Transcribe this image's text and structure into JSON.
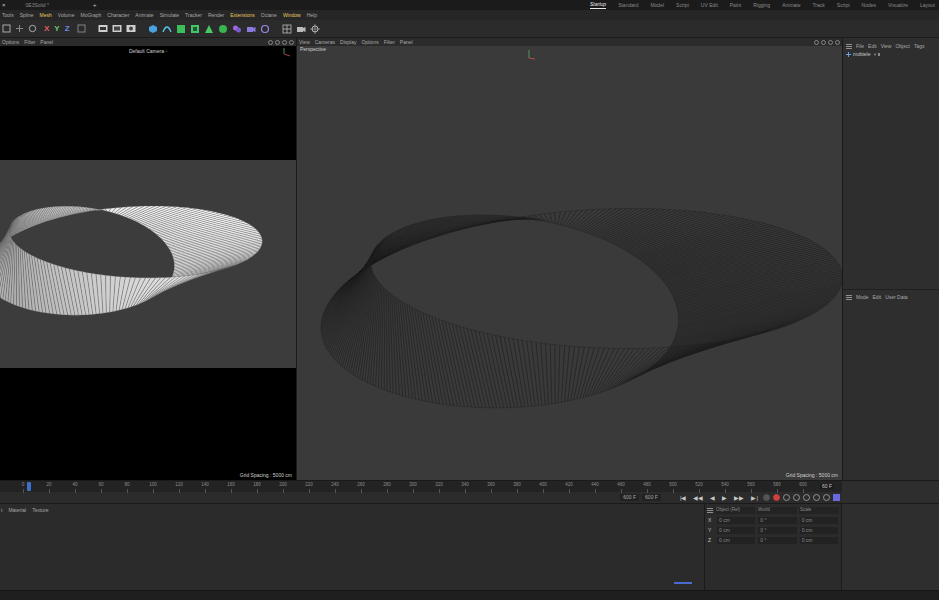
{
  "app_bar": {
    "close": "×",
    "document": "0E3Solid *",
    "add": "+"
  },
  "layouts": [
    {
      "label": "Startup",
      "selected": true
    },
    {
      "label": "Standard",
      "selected": false
    },
    {
      "label": "Model",
      "selected": false
    },
    {
      "label": "Script",
      "selected": false
    },
    {
      "label": "UV Edit",
      "selected": false
    },
    {
      "label": "Paint",
      "selected": false
    },
    {
      "label": "Rigging",
      "selected": false
    },
    {
      "label": "Animate",
      "selected": false
    },
    {
      "label": "Track",
      "selected": false
    },
    {
      "label": "Script",
      "selected": false
    },
    {
      "label": "Nodes",
      "selected": false
    },
    {
      "label": "Visualize",
      "selected": false
    },
    {
      "label": "Layout",
      "selected": false
    }
  ],
  "menu": [
    {
      "label": "Tools",
      "highlighted": false
    },
    {
      "label": "Spline",
      "highlighted": false
    },
    {
      "label": "Mesh",
      "highlighted": true
    },
    {
      "label": "Volume",
      "highlighted": false
    },
    {
      "label": "MoGraph",
      "highlighted": false
    },
    {
      "label": "Character",
      "highlighted": false
    },
    {
      "label": "Animate",
      "highlighted": false
    },
    {
      "label": "Simulate",
      "highlighted": false
    },
    {
      "label": "Tracker",
      "highlighted": false
    },
    {
      "label": "Render",
      "highlighted": false
    },
    {
      "label": "Extensions",
      "highlighted": true
    },
    {
      "label": "Octane",
      "highlighted": false
    },
    {
      "label": "Window",
      "highlighted": true
    },
    {
      "label": "Help",
      "highlighted": false
    }
  ],
  "axis_buttons": [
    {
      "label": "X",
      "color": "#e05a5a"
    },
    {
      "label": "Y",
      "color": "#6cc46c"
    },
    {
      "label": "Z",
      "color": "#6a8ae6"
    }
  ],
  "viewports": [
    {
      "menu": [
        "Options",
        "Filter",
        "Panel"
      ],
      "title": "Default Camera ◦",
      "grid": "Grid Spacing : 5000 cm",
      "kind": "shaded"
    },
    {
      "menu": [
        "View",
        "Cameras",
        "Display",
        "Options",
        "Filter",
        "Panel"
      ],
      "title": "Perspective",
      "grid": "Grid Spacing : 5000 cm",
      "kind": "wireframe"
    }
  ],
  "object_manager": {
    "menu": [
      "File",
      "Edit",
      "View",
      "Object",
      "Tags"
    ],
    "objects": [
      {
        "name": "mobiele",
        "selected": false
      }
    ]
  },
  "attributes": {
    "menu": [
      "Mode",
      "Edit",
      "User Data"
    ]
  },
  "timeline": {
    "ticks": [
      "0",
      "20",
      "40",
      "60",
      "80",
      "100",
      "120",
      "140",
      "160",
      "180",
      "200",
      "220",
      "240",
      "260",
      "280",
      "300",
      "320",
      "340",
      "360",
      "380",
      "400",
      "420",
      "440",
      "460",
      "480",
      "500",
      "520",
      "540",
      "560",
      "580",
      "600"
    ],
    "frame": "60 F",
    "playhead": {
      "level": 0.005
    }
  },
  "transport": {
    "start": "600 F",
    "end": "600 F",
    "buttons": [
      "|◀",
      "◀◀",
      "◀",
      "▶",
      "▶▶",
      "▶|"
    ]
  },
  "material_menu": [
    "t",
    "Material",
    "Texture"
  ],
  "coordinates": {
    "headers": [
      "Object (Rel)",
      "World",
      "Scale"
    ],
    "rows": [
      {
        "axis": "X",
        "position": "0 cm",
        "rotation": "0 °",
        "scale": "0 cm"
      },
      {
        "axis": "Y",
        "position": "0 cm",
        "rotation": "0 °",
        "scale": "0 cm"
      },
      {
        "axis": "Z",
        "position": "0 cm",
        "rotation": "0 °",
        "scale": "0 cm"
      }
    ]
  }
}
